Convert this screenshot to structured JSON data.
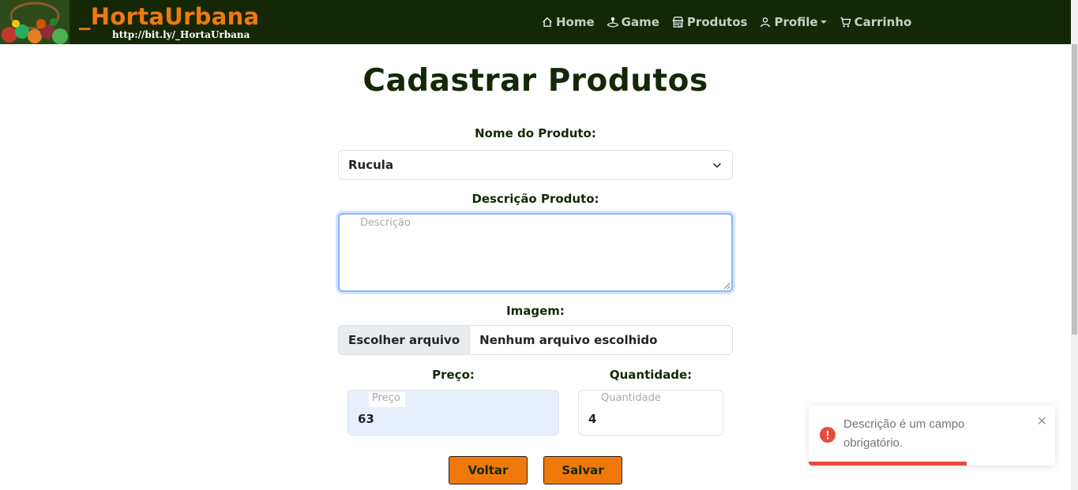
{
  "navbar": {
    "brand": "_HortaUrbana",
    "brand_url": "http://bit.ly/_HortaUrbana",
    "links": [
      {
        "label": "Home",
        "icon": "house-icon"
      },
      {
        "label": "Game",
        "icon": "joystick-icon"
      },
      {
        "label": "Produtos",
        "icon": "shop-icon"
      },
      {
        "label": "Profile",
        "icon": "person-icon"
      },
      {
        "label": "Carrinho",
        "icon": "cart-icon"
      }
    ]
  },
  "form": {
    "title": "Cadastrar Produtos",
    "product_name_label": "Nome do Produto:",
    "product_name_value": "Rucula",
    "description_label": "Descrição Produto:",
    "description_placeholder": "Descrição",
    "image_label": "Imagem:",
    "file_button": "Escolher arquivo",
    "file_status": "Nenhum arquivo escolhido",
    "price_label": "Preço:",
    "price_placeholder": "Preço",
    "price_value": "63",
    "quantity_label": "Quantidade:",
    "quantity_placeholder": "Quantidade",
    "quantity_value": "4",
    "back_button": "Voltar",
    "save_button": "Salvar"
  },
  "toast": {
    "message": "Descrição é um campo obrigatório.",
    "type": "error",
    "progress": 0.64
  },
  "colors": {
    "navbar_bg": "#142806",
    "accent": "#f0790c",
    "error": "#e74c3c"
  }
}
